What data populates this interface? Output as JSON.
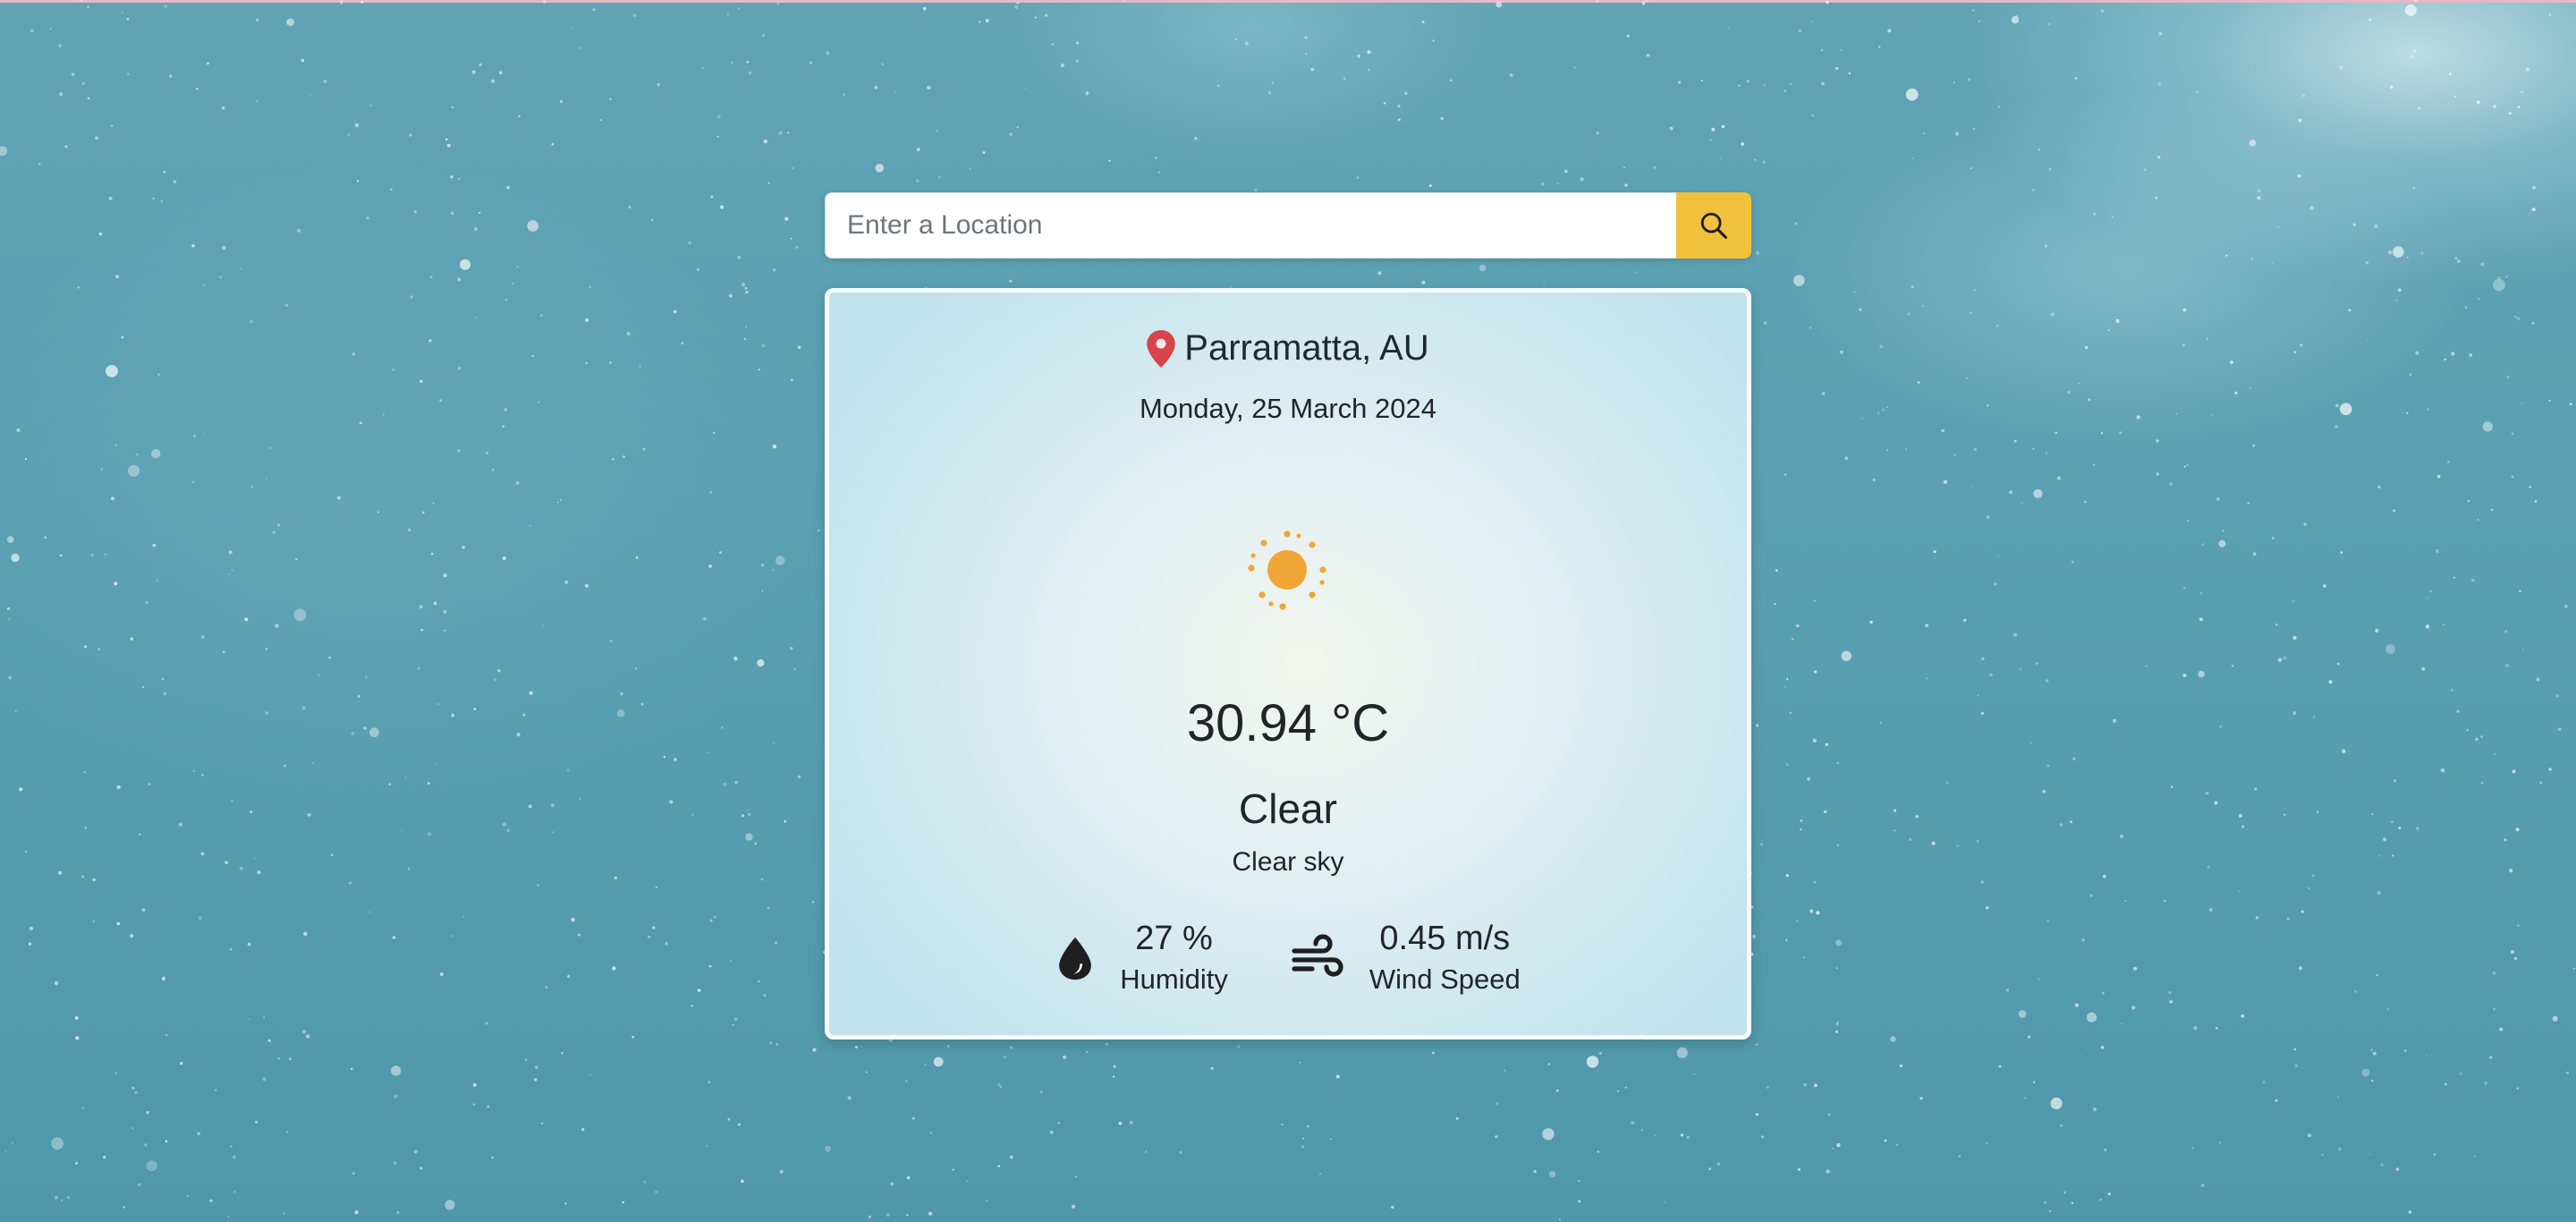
{
  "search": {
    "placeholder": "Enter a Location",
    "value": "",
    "button_icon": "search-icon"
  },
  "weather": {
    "location_icon": "map-pin-icon",
    "location": "Parramatta, AU",
    "date": "Monday, 25 March 2024",
    "condition_icon": "sun-icon",
    "temperature": "30.94 °C",
    "condition": "Clear",
    "description": "Clear sky",
    "humidity": {
      "icon": "droplet-icon",
      "value": "27 %",
      "label": "Humidity"
    },
    "wind": {
      "icon": "wind-icon",
      "value": "0.45 m/s",
      "label": "Wind Speed"
    }
  },
  "colors": {
    "accent": "#f2c13c",
    "pin": "#d9434b",
    "sun": "#f0a637",
    "background": "#5aa0b2"
  }
}
